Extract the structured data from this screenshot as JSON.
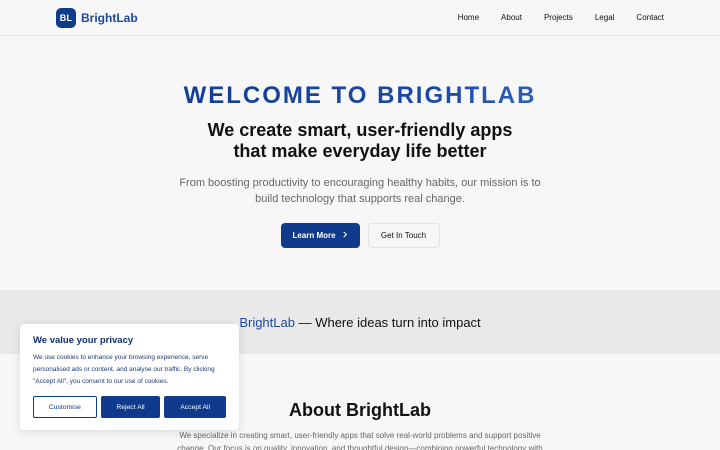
{
  "header": {
    "logo_badge": "BL",
    "brand_name": "BrightLab",
    "nav": [
      "Home",
      "About",
      "Projects",
      "Legal",
      "Contact"
    ]
  },
  "hero": {
    "title": "WELCOME TO BRIGHTLAB",
    "subtitle_line1": "We create smart, user-friendly apps",
    "subtitle_line2": "that make everyday life better",
    "description": "From boosting productivity to encouraging healthy habits, our mission is to build technology that supports real change.",
    "primary_button": "Learn More",
    "secondary_button": "Get In Touch"
  },
  "band": {
    "brand": "BrightLab",
    "tagline": " — Where ideas turn into impact"
  },
  "about": {
    "title": "About BrightLab",
    "text": "We specialize in creating smart, user-friendly apps that solve real-world problems and support positive change. Our focus is on quality, innovation, and thoughtful design—combining powerful technology with"
  },
  "cookie": {
    "title": "We value your privacy",
    "text": "We use cookies to enhance your browsing experience, serve personalised ads or content, and analyse our traffic. By clicking \"Accept All\", you consent to our use of cookies.",
    "customise": "Customise",
    "reject": "Reject All",
    "accept": "Accept All"
  },
  "colors": {
    "brand": "#103a8c",
    "background": "#f7f7f7",
    "band": "#e9e9e9"
  },
  "icons": {
    "learn_more_arrow": "chevron-right-icon"
  }
}
